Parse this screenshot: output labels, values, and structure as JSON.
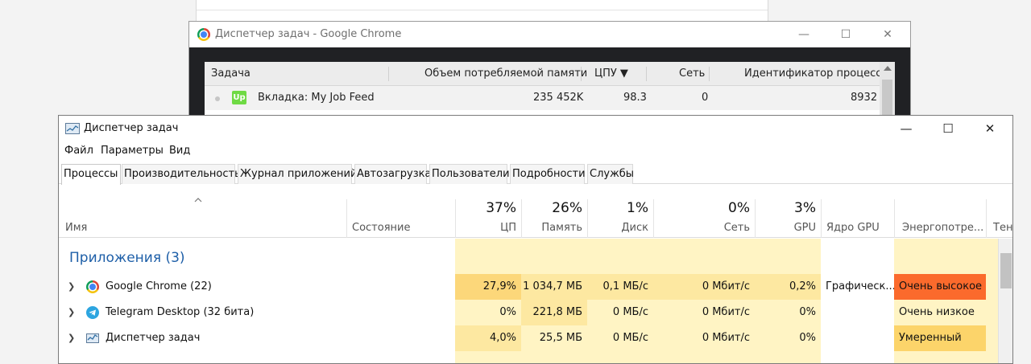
{
  "chrome_task_manager": {
    "title": "Диспетчер задач - Google Chrome",
    "window_controls": {
      "minimize": "—",
      "maximize": "☐",
      "close": "✕"
    },
    "columns": {
      "task": "Задача",
      "memory": "Объем потребляемой памяти",
      "cpu": "ЦПУ ▼",
      "network": "Сеть",
      "pid": "Идентификатор процесса"
    },
    "rows": [
      {
        "icon": "upwork-icon",
        "icon_text": "Up",
        "task": "Вкладка: My Job Feed",
        "memory": "235 452K",
        "cpu": "98.3",
        "network": "0",
        "pid": "8932"
      }
    ]
  },
  "task_manager": {
    "title": "Диспетчер задач",
    "window_controls": {
      "minimize": "—",
      "maximize": "☐",
      "close": "✕"
    },
    "menu": [
      "Файл",
      "Параметры",
      "Вид"
    ],
    "tabs": [
      "Процессы",
      "Производительность",
      "Журнал приложений",
      "Автозагрузка",
      "Пользователи",
      "Подробности",
      "Службы"
    ],
    "columns": {
      "name": "Имя",
      "status": "Состояние",
      "cpu": {
        "pct": "37%",
        "label": "ЦП"
      },
      "memory": {
        "pct": "26%",
        "label": "Память"
      },
      "disk": {
        "pct": "1%",
        "label": "Диск"
      },
      "network": {
        "pct": "0%",
        "label": "Сеть"
      },
      "gpu": {
        "pct": "3%",
        "label": "GPU"
      },
      "gpu_engine": "Ядро GPU",
      "power": "Энергопотре...",
      "power_trend": "Тен"
    },
    "group": "Приложения (3)",
    "processes": [
      {
        "name": "Google Chrome (22)",
        "icon": "chrome-icon",
        "cpu": "27,9%",
        "memory": "1 034,7 МБ",
        "disk": "0,1 МБ/с",
        "network": "0 Мбит/с",
        "gpu": "0,2%",
        "gpu_engine": "Графическ...",
        "power": "Очень высокое"
      },
      {
        "name": "Telegram Desktop (32 бита)",
        "icon": "telegram-icon",
        "cpu": "0%",
        "memory": "221,8 МБ",
        "disk": "0 МБ/с",
        "network": "0 Мбит/с",
        "gpu": "0%",
        "gpu_engine": "",
        "power": "Очень низкое"
      },
      {
        "name": "Диспетчер задач",
        "icon": "task-manager-icon",
        "cpu": "4,0%",
        "memory": "25,5 МБ",
        "disk": "0 МБ/с",
        "network": "0 Мбит/с",
        "gpu": "0%",
        "gpu_engine": "",
        "power": "Умеренный"
      }
    ],
    "colors": {
      "heat_light": "#fff4c4",
      "heat_mid": "#fde8a1",
      "heat_strong": "#fcd77a",
      "power_very_high": "#fb6a2c",
      "power_moderate": "#fcd46a",
      "group_text": "#1e5fa8"
    }
  }
}
